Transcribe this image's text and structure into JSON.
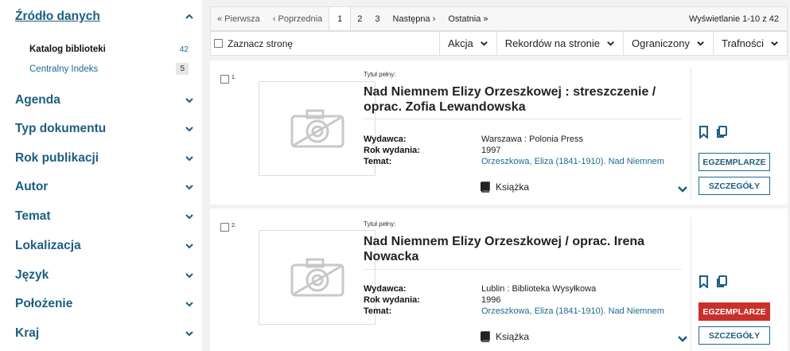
{
  "sidebar": {
    "source": {
      "title": "Źródło danych",
      "items": [
        {
          "label": "Katalog biblioteki",
          "count": "42"
        },
        {
          "label": "Centralny Indeks",
          "count": "5"
        }
      ]
    },
    "facets": [
      "Agenda",
      "Typ dokumentu",
      "Rok publikacji",
      "Autor",
      "Temat",
      "Lokalizacja",
      "Język",
      "Położenie",
      "Kraj"
    ]
  },
  "pager": {
    "first": "« Pierwsza",
    "prev": "‹ Poprzednia",
    "pages": [
      "1",
      "2",
      "3"
    ],
    "current": "1",
    "next": "Następna ›",
    "last": "Ostatnia »",
    "info": "Wyświetlanie 1-10 z 42"
  },
  "toolbar": {
    "select_page": "Zaznacz stronę",
    "action": "Akcja",
    "per_page": "Rekordów na stronie",
    "limited": "Ograniczony",
    "relevance": "Trafności"
  },
  "labels": {
    "full_title": "Tytuł pełny:",
    "publisher": "Wydawca:",
    "year": "Rok wydania:",
    "subject": "Temat:",
    "copies_button": "EGZEMPLARZE",
    "details_button": "SZCZEGÓŁY"
  },
  "results": [
    {
      "num": "1.",
      "title": "Nad Niemnem Elizy Orzeszkowej : streszczenie / oprac. Zofia Lewandowska",
      "publisher": "Warszawa : Polonia Press",
      "year": "1997",
      "subject": "Orzeszkowa, Eliza (1841-1910). Nad Niemnem",
      "type": "Książka"
    },
    {
      "num": "2.",
      "title": "Nad Niemnem Elizy Orzeszkowej / oprac. Irena Nowacka",
      "publisher": "Lublin : Biblioteka Wysyłkowa",
      "year": "1996",
      "subject": "Orzeszkowa, Eliza (1841-1910). Nad Niemnem",
      "type": "Książka"
    }
  ],
  "colors": {
    "accent": "#1d5e80",
    "link": "#1d6a93",
    "danger": "#c9302c"
  },
  "icons": [
    "chevron-up-icon",
    "chevron-down-icon",
    "camera-placeholder-icon",
    "book-icon",
    "bookmark-icon",
    "copy-icon"
  ]
}
